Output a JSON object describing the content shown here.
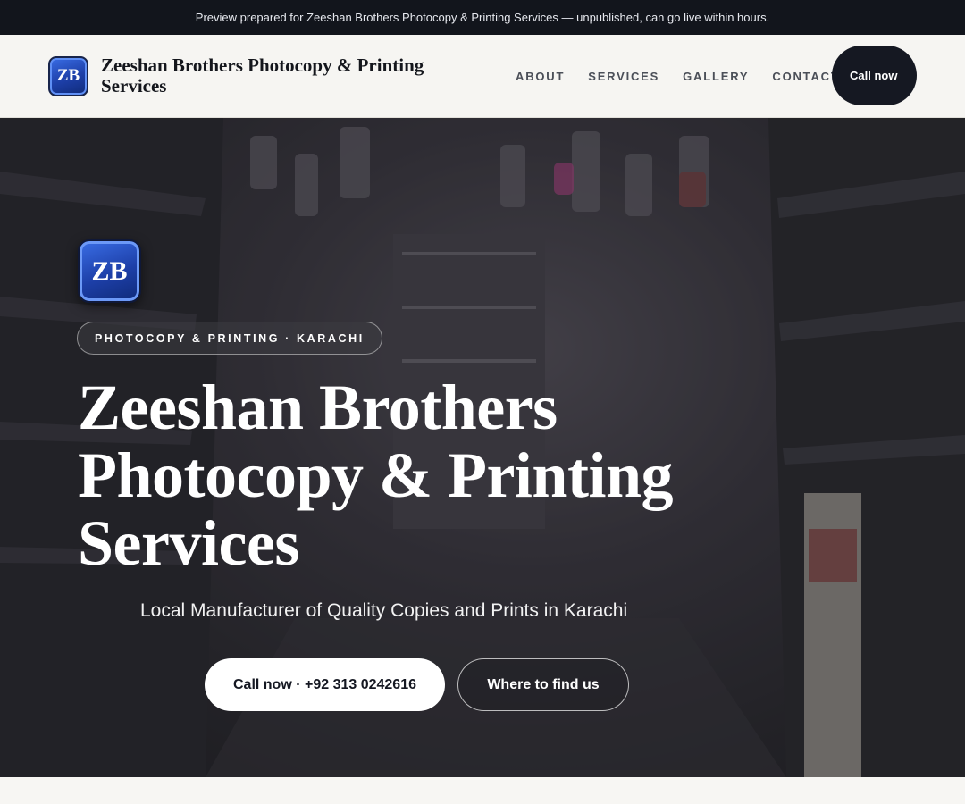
{
  "topbar": {
    "notice": "Preview prepared for Zeeshan Brothers Photocopy & Printing Services — unpublished, can go live within hours."
  },
  "header": {
    "logo_text": "ZB",
    "brand_name": "Zeeshan Brothers Photocopy & Printing Services",
    "nav": [
      {
        "label": "ABOUT"
      },
      {
        "label": "SERVICES"
      },
      {
        "label": "GALLERY"
      },
      {
        "label": "CONTACT"
      }
    ],
    "call_label": "Call now"
  },
  "hero": {
    "logo_text": "ZB",
    "pill": "PHOTOCOPY & PRINTING · KARACHI",
    "title": "Zeeshan Brothers Photocopy & Printing Services",
    "subtitle": "Local Manufacturer of Quality Copies and Prints in Karachi",
    "primary_button": "Call now · +92 313 0242616",
    "secondary_button": "Where to find us"
  },
  "colors": {
    "topbar_bg": "#12151c",
    "header_bg": "#f6f5f2",
    "accent_blue": "#1d3fa8",
    "dark_button": "#151822"
  }
}
